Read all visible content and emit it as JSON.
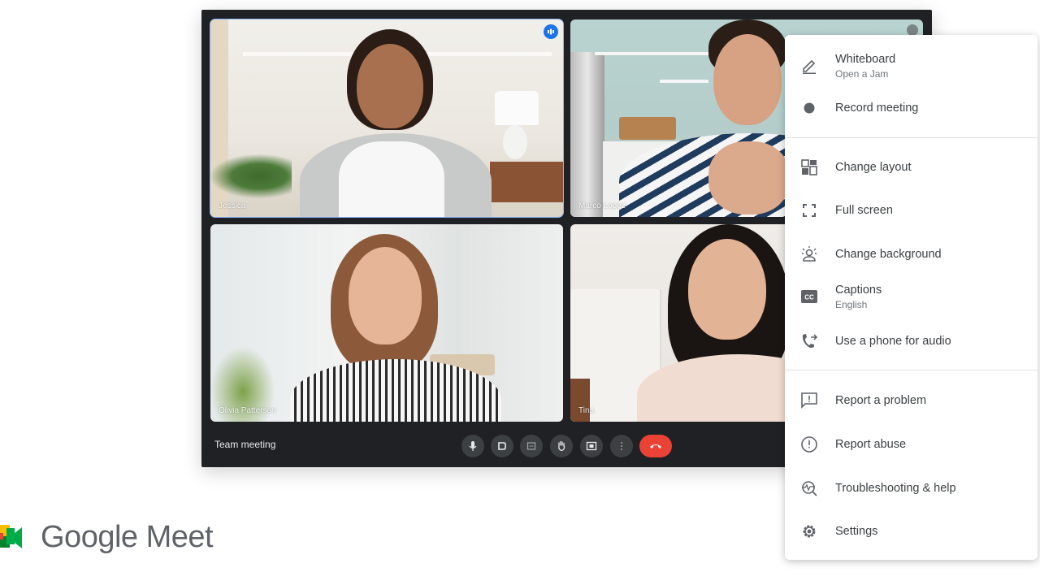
{
  "meeting": {
    "title": "Team meeting",
    "participants": [
      {
        "name": "Jessica",
        "active_speaker": true
      },
      {
        "name": "Marco Lopez",
        "muted": true
      },
      {
        "name": "Olivia Patterson"
      },
      {
        "name": "Tina"
      }
    ],
    "controls": [
      {
        "id": "mic",
        "icon": "microphone-icon"
      },
      {
        "id": "camera",
        "icon": "camera-icon"
      },
      {
        "id": "captions",
        "icon": "captions-icon"
      },
      {
        "id": "raise-hand",
        "icon": "hand-icon"
      },
      {
        "id": "present",
        "icon": "present-screen-icon"
      },
      {
        "id": "more",
        "icon": "more-vert-icon"
      },
      {
        "id": "leave",
        "icon": "end-call-icon"
      }
    ],
    "colors": {
      "frame": "#202124",
      "active_outline": "#8ab4f8",
      "end_call": "#ea4335",
      "speaking": "#1a73e8"
    }
  },
  "menu": {
    "items": [
      {
        "label": "Whiteboard",
        "sublabel": "Open a Jam",
        "icon": "pencil-icon"
      },
      {
        "label": "Record meeting",
        "icon": "record-dot-icon"
      },
      {
        "label": "Change layout",
        "icon": "layout-icon"
      },
      {
        "label": "Full screen",
        "icon": "fullscreen-icon"
      },
      {
        "label": "Change background",
        "icon": "background-person-icon"
      },
      {
        "label": "Captions",
        "sublabel": "English",
        "icon": "cc-icon"
      },
      {
        "label": "Use a phone for audio",
        "icon": "phone-forward-icon"
      },
      {
        "label": "Report a problem",
        "icon": "feedback-icon"
      },
      {
        "label": "Report abuse",
        "icon": "alert-circle-icon"
      },
      {
        "label": "Troubleshooting & help",
        "icon": "troubleshoot-icon"
      },
      {
        "label": "Settings",
        "icon": "gear-icon"
      }
    ]
  },
  "brand": {
    "name": "Google Meet"
  }
}
